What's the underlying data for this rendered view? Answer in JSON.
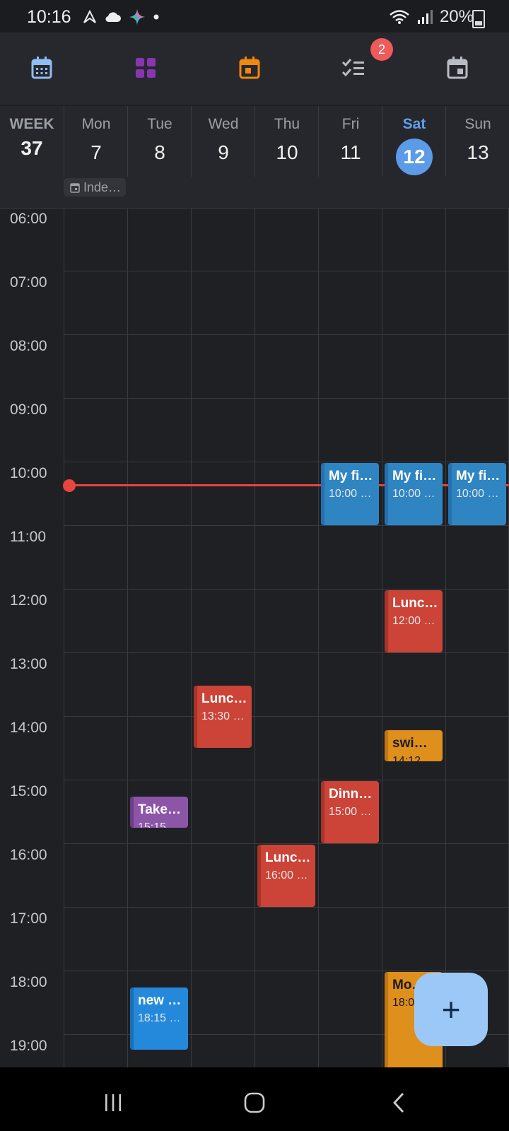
{
  "status": {
    "time": "10:16",
    "battery": "20%"
  },
  "toolbar": {
    "badge_count": "2"
  },
  "header": {
    "week_label": "WEEK",
    "week_number": "37",
    "days": [
      {
        "name": "Mon",
        "date": "7"
      },
      {
        "name": "Tue",
        "date": "8"
      },
      {
        "name": "Wed",
        "date": "9"
      },
      {
        "name": "Thu",
        "date": "10"
      },
      {
        "name": "Fri",
        "date": "11"
      },
      {
        "name": "Sat",
        "date": "12"
      },
      {
        "name": "Sun",
        "date": "13"
      }
    ],
    "allday_event": "Inde…"
  },
  "hours": [
    "06:00",
    "07:00",
    "08:00",
    "09:00",
    "10:00",
    "11:00",
    "12:00",
    "13:00",
    "14:00",
    "15:00",
    "16:00",
    "17:00",
    "18:00",
    "19:00"
  ],
  "events": [
    {
      "title": "My fi…",
      "sub": "10:00 …"
    },
    {
      "title": "My fi…",
      "sub": "10:00 …"
    },
    {
      "title": "My fi…",
      "sub": "10:00 …"
    },
    {
      "title": "Lunc…",
      "sub": "12:00 …"
    },
    {
      "title": "Lunc…",
      "sub": "13:30 …"
    },
    {
      "title": "swi…",
      "sub": "14:12 …"
    },
    {
      "title": "Take…",
      "sub": "15:15 …"
    },
    {
      "title": "Dinn…",
      "sub": "15:00 …"
    },
    {
      "title": "Lunc…",
      "sub": "16:00 …"
    },
    {
      "title": "new …",
      "sub": "18:15 …"
    },
    {
      "title": "Mo…",
      "sub": "18:0…"
    }
  ],
  "fab": {
    "label": "+"
  }
}
